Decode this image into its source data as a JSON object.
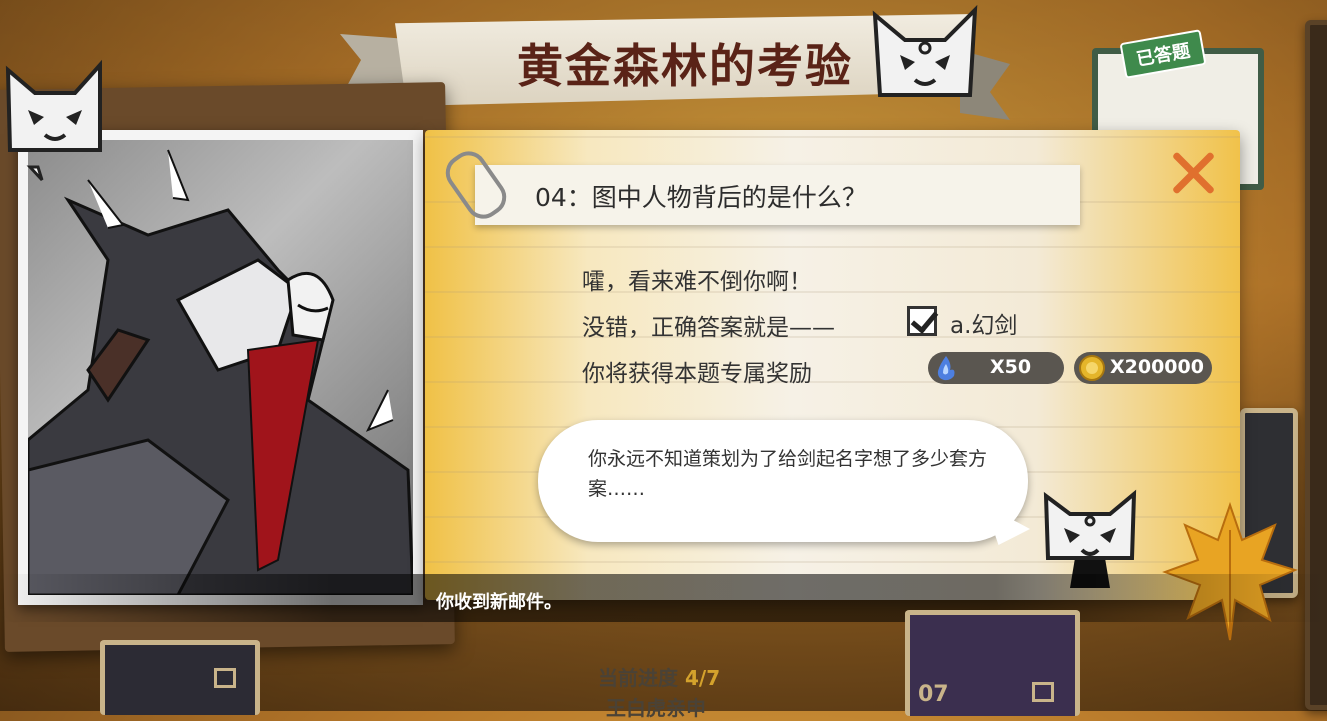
{
  "title": "黄金森林的考验",
  "answered_badge": "已答题",
  "question": {
    "text": "04：图中人物背后的是什么？"
  },
  "dialog": {
    "line1": "嚯，看来难不倒你啊！",
    "line2": "没错，正确答案就是——",
    "answer": "a.幻剑",
    "line3": "你将获得本题专属奖励"
  },
  "rewards": [
    {
      "icon": "blue-flame-icon",
      "label": "X50",
      "color": "#4d7fe0"
    },
    {
      "icon": "gold-coin-icon",
      "label": "X200000",
      "color": "#e5b52a"
    }
  ],
  "speech": "你永远不知道策划为了给剑起名字想了多少套方案……",
  "toast": "你收到新邮件。",
  "progress": {
    "label": "当前进度",
    "value": "4/7",
    "subtitle": "王白虎亲申"
  },
  "bottom_card": {
    "number": "07"
  },
  "colors": {
    "accent": "#e0702e",
    "title": "#5a2317",
    "badge": "#3f8a4c"
  }
}
